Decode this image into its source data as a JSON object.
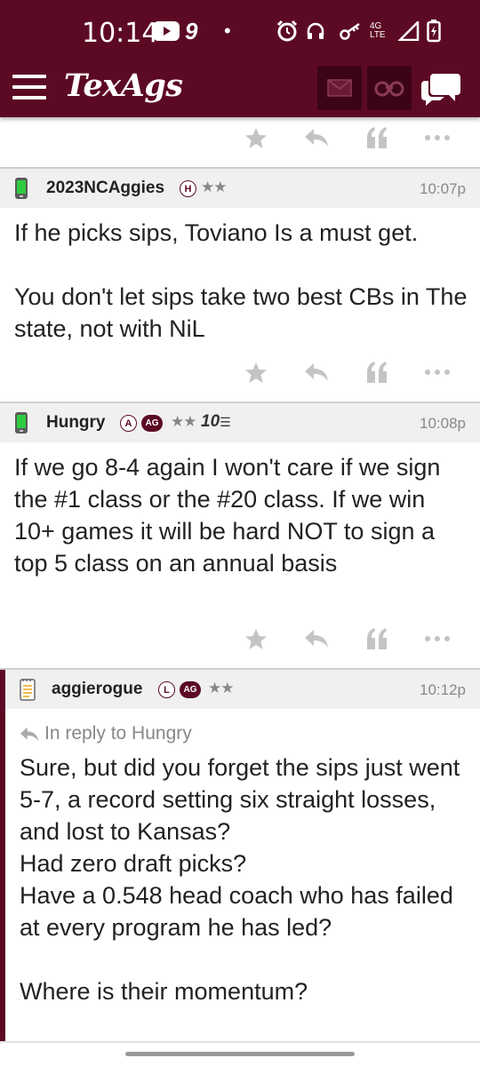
{
  "status_bar": {
    "time": "10:14",
    "notif_count": "9",
    "network_label": "4G LTE"
  },
  "header": {
    "logo": "TexAgs"
  },
  "posts": [
    {
      "username": "2023NCAggies",
      "badges": [
        "H"
      ],
      "stars": "★★",
      "time": "10:07p",
      "body": "If he picks sips, Toviano Is a must get.\n\nYou don't let sips take two best CBs in The state, not with NiL"
    },
    {
      "username": "Hungry",
      "badges": [
        "A",
        "AG"
      ],
      "stars": "★★",
      "extra_badge": "10",
      "time": "10:08p",
      "body": "If we go 8-4 again I won't care if we sign the #1 class or the #20 class. If we win 10+ games it will be hard NOT to sign a top 5 class on an annual basis"
    },
    {
      "username": "aggierogue",
      "badges": [
        "L",
        "AG"
      ],
      "stars": "★★",
      "time": "10:12p",
      "reply_to": "In reply to Hungry",
      "body": "Sure, but did you forget the sips just went 5-7, a record setting six straight losses, and lost to Kansas?\nHad zero draft picks?\nHave a 0.548 head coach who has failed at every program he has led?\n\nWhere is their momentum?"
    }
  ],
  "colors": {
    "brand": "#5c0a24",
    "brand_dark": "#3c0418",
    "header_bg": "#f0f0f0",
    "meta_gray": "#888888"
  },
  "icons": [
    "menu-icon",
    "mail-icon",
    "binoculars-icon",
    "chat-icon",
    "star-icon",
    "reply-icon",
    "quote-icon",
    "more-icon",
    "phone-icon",
    "notepad-icon"
  ]
}
